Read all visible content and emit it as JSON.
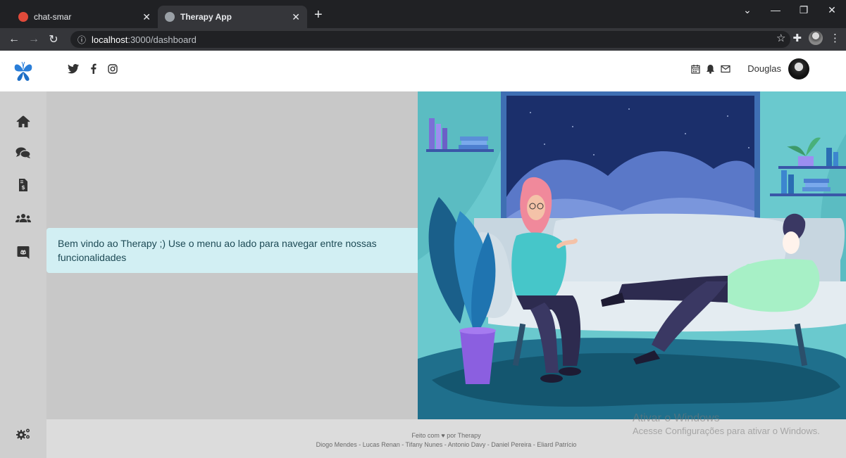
{
  "browser": {
    "tabs": [
      {
        "title": "chat-smar",
        "active": false
      },
      {
        "title": "Therapy App",
        "active": true
      }
    ],
    "url_host": "localhost",
    "url_path": ":3000/dashboard"
  },
  "header": {
    "social_icons": [
      "twitter-icon",
      "facebook-icon",
      "instagram-icon"
    ],
    "username": "Douglas"
  },
  "sidebar": {
    "items": [
      "home-icon",
      "chat-icon",
      "invoice-icon",
      "users-icon",
      "discord-icon"
    ],
    "bottom": "settings-icon"
  },
  "main": {
    "welcome_message": "Bem vindo ao Therapy ;) Use o menu ao lado para navegar entre nossas funcionalidades"
  },
  "footer": {
    "made_with_prefix": "Feito com",
    "made_with_suffix": "por Therapy",
    "authors": "Diogo Mendes - Lucas Renan - Tifany Nunes - Antonio Davy - Daniel Pereira - Eliard Patrício"
  },
  "watermark": {
    "line1": "Ativar o Windows",
    "line2": "Acesse Configurações para ativar o Windows."
  },
  "colors": {
    "accent": "#2a7ed8",
    "welcome_bg": "#d2eff3",
    "illustration_bg": "#6ac9ce"
  }
}
